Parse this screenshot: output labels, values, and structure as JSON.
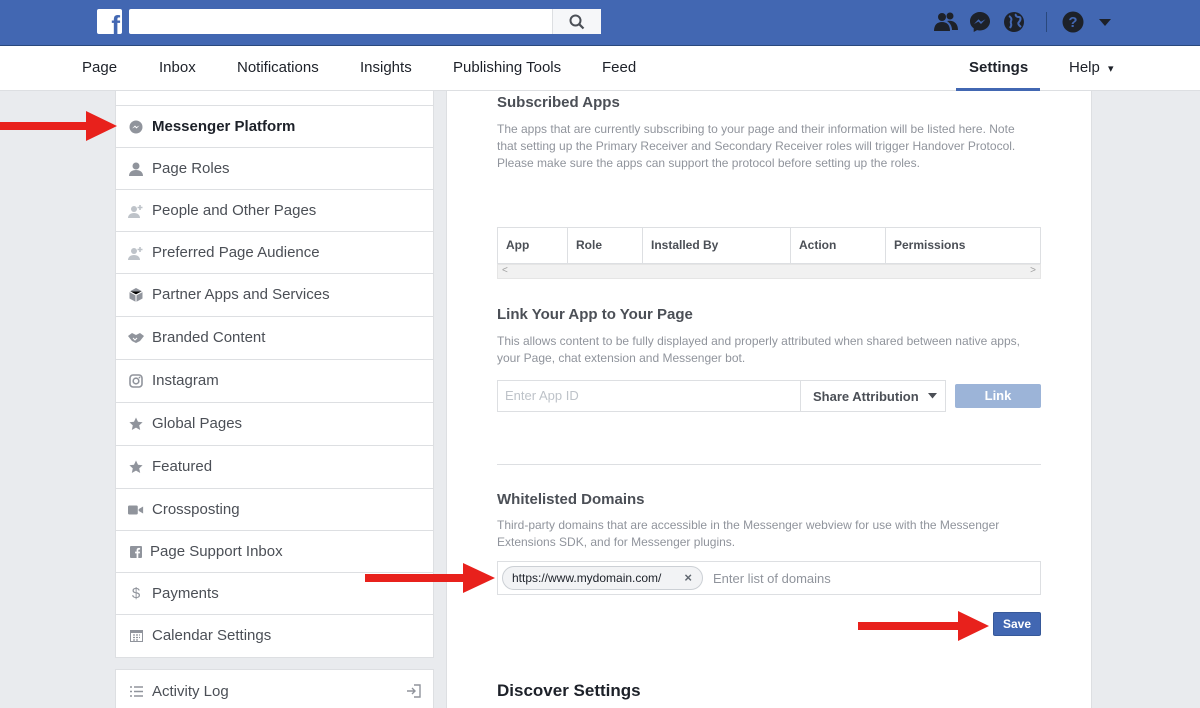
{
  "topbar": {
    "logo": "f",
    "search_placeholder": "",
    "icons": [
      "search-icon",
      "friends-icon",
      "messenger-icon",
      "globe-icon",
      "help-icon",
      "caret-down-icon"
    ],
    "brand_color": "#4267b2"
  },
  "nav": {
    "items": [
      "Page",
      "Inbox",
      "Notifications",
      "Insights",
      "Publishing Tools",
      "Feed"
    ],
    "settings": "Settings",
    "help": "Help",
    "help_caret": "▾"
  },
  "sidebar": {
    "items": [
      {
        "label": "Messenger Platform",
        "icon": "messenger-icon"
      },
      {
        "label": "Page Roles",
        "icon": "person-icon"
      },
      {
        "label": "People and Other Pages",
        "icon": "person-add-icon"
      },
      {
        "label": "Preferred Page Audience",
        "icon": "person-add-icon"
      },
      {
        "label": "Partner Apps and Services",
        "icon": "cube-icon"
      },
      {
        "label": "Branded Content",
        "icon": "handshake-icon"
      },
      {
        "label": "Instagram",
        "icon": "instagram-icon"
      },
      {
        "label": "Global Pages",
        "icon": "star-icon"
      },
      {
        "label": "Featured",
        "icon": "star-icon"
      },
      {
        "label": "Crossposting",
        "icon": "video-icon"
      },
      {
        "label": "Page Support Inbox",
        "icon": "facebook-icon"
      },
      {
        "label": "Payments",
        "icon": "dollar-icon"
      },
      {
        "label": "Calendar Settings",
        "icon": "calendar-icon"
      }
    ],
    "activity_log": "Activity Log"
  },
  "main": {
    "subscribed": {
      "title": "Subscribed Apps",
      "desc": "The apps that are currently subscribing to your page and their information will be listed here. Note that setting up the Primary Receiver and Secondary Receiver roles will trigger Handover Protocol. Please make sure the apps can support the protocol before setting up the roles.",
      "columns": [
        "App",
        "Role",
        "Installed By",
        "Action",
        "Permissions"
      ],
      "scroll_left": "<",
      "scroll_right": ">"
    },
    "link_app": {
      "title": "Link Your App to Your Page",
      "desc": "This allows content to be fully displayed and properly attributed when shared between native apps, your Page, chat extension and Messenger bot.",
      "input_placeholder": "Enter App ID",
      "share_label": "Share Attribution",
      "link_label": "Link"
    },
    "whitelist": {
      "title": "Whitelisted Domains",
      "desc": "Third-party domains that are accessible in the Messenger webview for use with the Messenger Extensions SDK, and for Messenger plugins.",
      "domain": "https://www.mydomain.com/",
      "remove": "×",
      "placeholder": "Enter list of domains",
      "save_label": "Save"
    },
    "discover_title": "Discover Settings"
  },
  "annotations": {
    "arrow_color": "#e8211c"
  }
}
